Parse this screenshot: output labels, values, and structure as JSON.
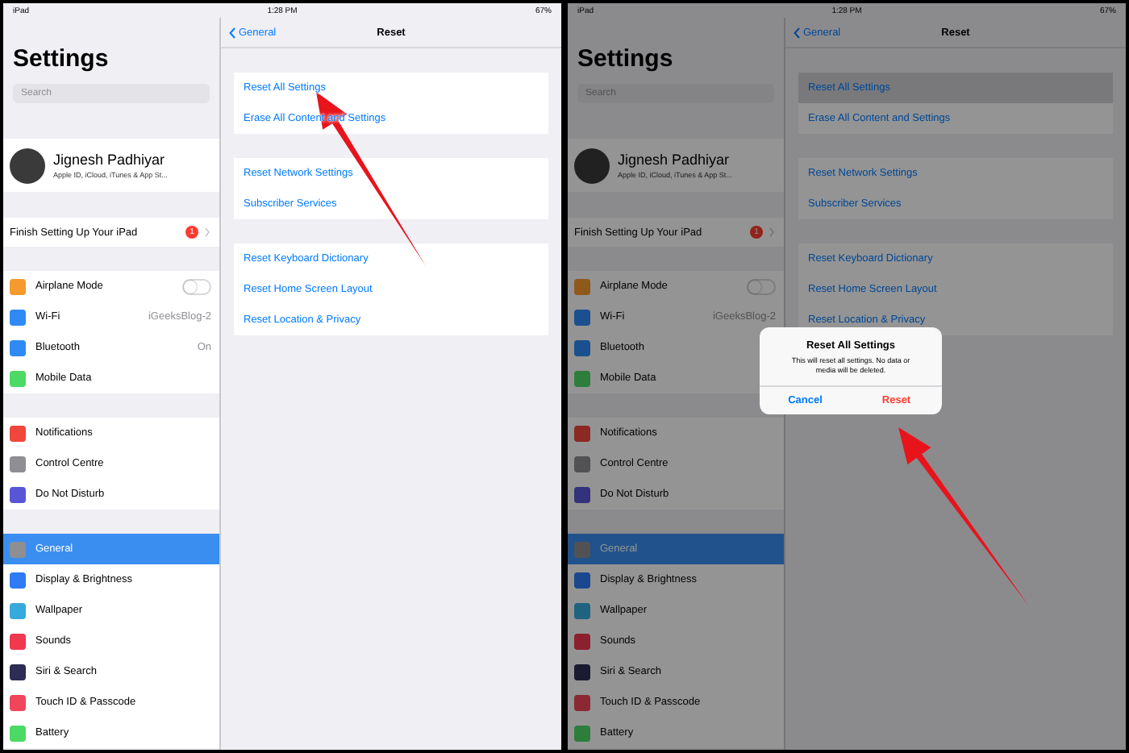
{
  "screens": [
    {
      "status_bar": {
        "carrier": "iPad",
        "time": "1:28 PM",
        "battery": "67%"
      },
      "dimmed": false,
      "sidebar": {
        "title": "Settings",
        "search": {
          "placeholder": "Search"
        },
        "profile": {
          "name": "Jignesh Padhiyar",
          "subtitle": "Apple ID, iCloud, iTunes & App St..."
        },
        "finish": {
          "label": "Finish Setting Up Your iPad",
          "badge": "1"
        },
        "groups": [
          [
            {
              "label": "Airplane Mode",
              "kind": "toggle",
              "on": false,
              "color": "#f59a2c",
              "selected": false
            },
            {
              "label": "Wi-Fi",
              "kind": "value",
              "value": "iGeeksBlog-2",
              "color": "#2f8af5",
              "selected": false
            },
            {
              "label": "Bluetooth",
              "kind": "value",
              "value": "On",
              "color": "#2f8af5",
              "selected": false
            },
            {
              "label": "Mobile Data",
              "kind": "plain",
              "color": "#4cd964",
              "selected": false
            }
          ],
          [
            {
              "label": "Notifications",
              "kind": "plain",
              "color": "#f0463c",
              "selected": false
            },
            {
              "label": "Control Centre",
              "kind": "plain",
              "color": "#8e8e93",
              "selected": false
            },
            {
              "label": "Do Not Disturb",
              "kind": "plain",
              "color": "#5856d6",
              "selected": false
            }
          ],
          [
            {
              "label": "General",
              "kind": "plain",
              "color": "#8e8e93",
              "selected": true
            },
            {
              "label": "Display & Brightness",
              "kind": "plain",
              "color": "#2f7bf5",
              "selected": false
            },
            {
              "label": "Wallpaper",
              "kind": "plain",
              "color": "#36aadc",
              "selected": false
            },
            {
              "label": "Sounds",
              "kind": "plain",
              "color": "#f0384f",
              "selected": false
            },
            {
              "label": "Siri & Search",
              "kind": "plain",
              "color": "#2c2c54",
              "selected": false
            },
            {
              "label": "Touch ID & Passcode",
              "kind": "plain",
              "color": "#f0455a",
              "selected": false
            },
            {
              "label": "Battery",
              "kind": "plain",
              "color": "#4cd964",
              "selected": false
            }
          ]
        ]
      },
      "detail": {
        "back": "General",
        "title": "Reset",
        "groups": [
          [
            {
              "label": "Reset All Settings",
              "selected": false
            },
            {
              "label": "Erase All Content and Settings",
              "selected": false
            }
          ],
          [
            {
              "label": "Reset Network Settings",
              "selected": false
            },
            {
              "label": "Subscriber Services",
              "selected": false
            }
          ],
          [
            {
              "label": "Reset Keyboard Dictionary",
              "selected": false
            },
            {
              "label": "Reset Home Screen Layout",
              "selected": false
            },
            {
              "label": "Reset Location & Privacy",
              "selected": false
            }
          ]
        ]
      }
    },
    {
      "status_bar": {
        "carrier": "iPad",
        "time": "1:28 PM",
        "battery": "67%"
      },
      "dimmed": true,
      "sidebar": {
        "title": "Settings",
        "search": {
          "placeholder": "Search"
        },
        "profile": {
          "name": "Jignesh Padhiyar",
          "subtitle": "Apple ID, iCloud, iTunes & App St..."
        },
        "finish": {
          "label": "Finish Setting Up Your iPad",
          "badge": "1"
        },
        "groups": [
          [
            {
              "label": "Airplane Mode",
              "kind": "toggle",
              "on": false,
              "color": "#8e591a",
              "selected": false
            },
            {
              "label": "Wi-Fi",
              "kind": "value",
              "value": "iGeeksBlog-2",
              "color": "#1b508e",
              "selected": false
            },
            {
              "label": "Bluetooth",
              "kind": "plain",
              "color": "#1b508e",
              "selected": false
            },
            {
              "label": "Mobile Data",
              "kind": "plain",
              "color": "#2c7e3a",
              "selected": false
            }
          ],
          [
            {
              "label": "Notifications",
              "kind": "plain",
              "color": "#8b2923",
              "selected": false
            },
            {
              "label": "Control Centre",
              "kind": "plain",
              "color": "#525255",
              "selected": false
            },
            {
              "label": "Do Not Disturb",
              "kind": "plain",
              "color": "#33327c",
              "selected": false
            }
          ],
          [
            {
              "label": "General",
              "kind": "plain",
              "color": "#525255",
              "selected": true
            },
            {
              "label": "Display & Brightness",
              "kind": "plain",
              "color": "#1b478e",
              "selected": false
            },
            {
              "label": "Wallpaper",
              "kind": "plain",
              "color": "#1f6380",
              "selected": false
            },
            {
              "label": "Sounds",
              "kind": "plain",
              "color": "#8b202e",
              "selected": false
            },
            {
              "label": "Siri & Search",
              "kind": "plain",
              "color": "#1a1a31",
              "selected": false
            },
            {
              "label": "Touch ID & Passcode",
              "kind": "plain",
              "color": "#8b2834",
              "selected": false
            },
            {
              "label": "Battery",
              "kind": "plain",
              "color": "#2c7e3a",
              "selected": false
            }
          ]
        ]
      },
      "detail": {
        "back": "General",
        "title": "Reset",
        "groups": [
          [
            {
              "label": "Reset All Settings",
              "selected": true
            },
            {
              "label": "Erase All Content and Settings",
              "selected": false
            }
          ],
          [
            {
              "label": "Reset Network Settings",
              "selected": false
            },
            {
              "label": "Subscriber Services",
              "selected": false
            }
          ],
          [
            {
              "label": "Reset Keyboard Dictionary",
              "selected": false
            },
            {
              "label": "Reset Home Screen Layout",
              "selected": false
            },
            {
              "label": "Reset Location & Privacy",
              "selected": false
            }
          ]
        ]
      },
      "alert": {
        "title": "Reset All Settings",
        "message": "This will reset all settings. No data or media will be deleted.",
        "buttons": [
          {
            "label": "Cancel",
            "kind": "cancel"
          },
          {
            "label": "Reset",
            "kind": "destructive"
          }
        ]
      }
    }
  ]
}
